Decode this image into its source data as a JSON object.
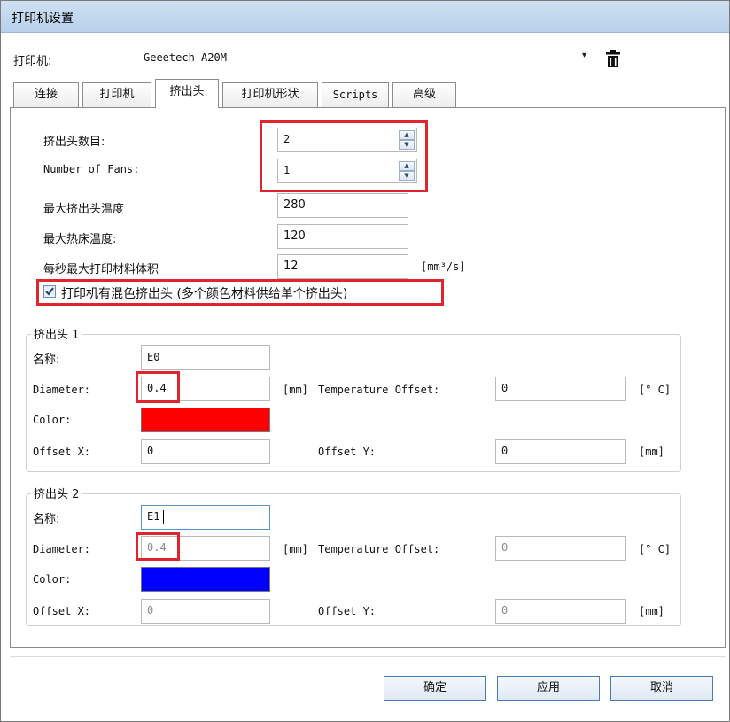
{
  "window": {
    "title": "打印机设置"
  },
  "printer": {
    "label": "打印机:",
    "selected": "Geeetech A20M",
    "arrow_glyph": "▾"
  },
  "tabs": [
    {
      "label": "连接",
      "active": false
    },
    {
      "label": "打印机",
      "active": false
    },
    {
      "label": "挤出头",
      "active": true
    },
    {
      "label": "打印机形状",
      "active": false
    },
    {
      "label": "Scripts",
      "active": false
    },
    {
      "label": "高级",
      "active": false
    }
  ],
  "extruder_settings": {
    "count_label": "挤出头数目:",
    "count_value": "2",
    "fans_label": "Number of Fans:",
    "fans_value": "1",
    "max_extruder_temp_label": "最大挤出头温度",
    "max_extruder_temp_value": "280",
    "max_bed_temp_label": "最大热床温度:",
    "max_bed_temp_value": "120",
    "max_volume_label": "每秒最大打印材料体积",
    "max_volume_value": "12",
    "max_volume_unit": "[mm³/s]",
    "mixing_checkbox_label": "打印机有混色挤出头 (多个颜色材料供给单个挤出头)",
    "mixing_checked": true
  },
  "extruders": [
    {
      "group_title": "挤出头 1",
      "name_label": "名称:",
      "name_value": "E0",
      "diameter_label": "Diameter:",
      "diameter_value": "0.4",
      "diameter_unit": "[mm]",
      "temp_offset_label": "Temperature Offset:",
      "temp_offset_value": "0",
      "temp_offset_unit": "[° C]",
      "color_label": "Color:",
      "color": "#ff0000",
      "offset_x_label": "Offset X:",
      "offset_x_value": "0",
      "offset_y_label": "Offset Y:",
      "offset_y_value": "0",
      "offset_unit": "[mm]"
    },
    {
      "group_title": "挤出头 2",
      "name_label": "名称:",
      "name_value": "E1",
      "diameter_label": "Diameter:",
      "diameter_value": "0.4",
      "diameter_unit": "[mm]",
      "temp_offset_label": "Temperature Offset:",
      "temp_offset_value": "0",
      "temp_offset_unit": "[° C]",
      "color_label": "Color:",
      "color": "#0000ff",
      "offset_x_label": "Offset X:",
      "offset_x_value": "0",
      "offset_y_label": "Offset Y:",
      "offset_y_value": "0",
      "offset_unit": "[mm]"
    }
  ],
  "buttons": {
    "ok": "确定",
    "apply": "应用",
    "cancel": "取消"
  },
  "colors": {
    "highlight_border": "#e0262c",
    "titlebar": "#b8d1ec",
    "button_border": "#4a7bb7"
  }
}
